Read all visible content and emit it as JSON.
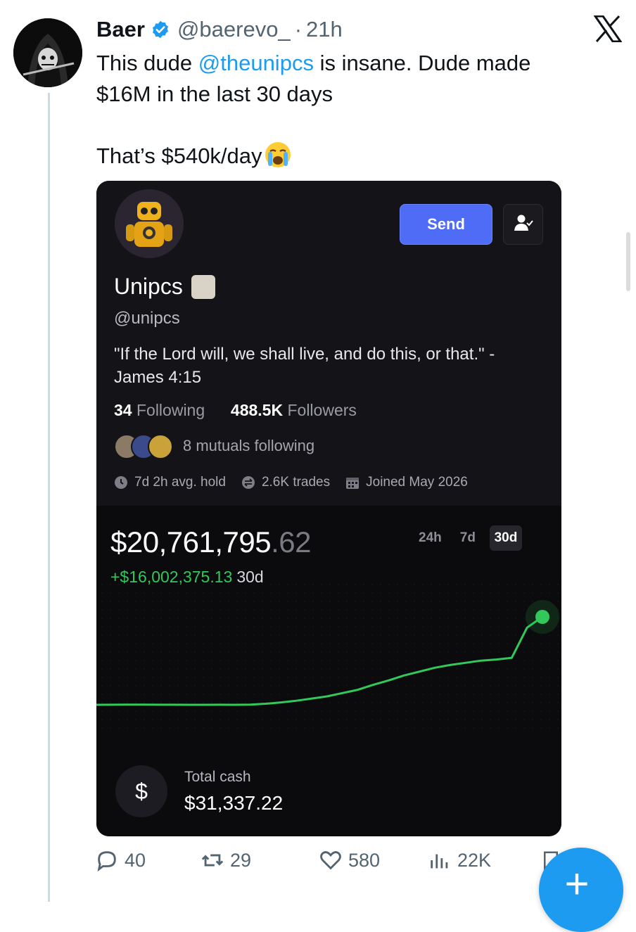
{
  "tweet": {
    "author_name": "Baer",
    "author_handle": "@baerevo_",
    "separator": "·",
    "time": "21h",
    "text_line1_pre": "This dude ",
    "mention": "@theunipcs",
    "text_line1_post": " is insane. Dude made",
    "text_line2": "$16M in the last 30 days",
    "text_line3": "That’s $540k/day"
  },
  "card": {
    "send_label": "Send",
    "display_name": "Unipcs",
    "handle": "@unipcs",
    "bio": "\"If the Lord will, we shall live, and do this, or that.\" - James 4:15",
    "following_count": "34",
    "following_label": "Following",
    "followers_count": "488.5K",
    "followers_label": "Followers",
    "mutuals_text": "8 mutuals following",
    "avg_hold": "7d 2h avg. hold",
    "trades": "2.6K trades",
    "joined": "Joined May 2026",
    "balance_main": "$20,761,795",
    "balance_cents": ".62",
    "gain": "+$16,002,375.13",
    "gain_period": "30d",
    "ranges": [
      "24h",
      "7d",
      "30d"
    ],
    "active_range": "30d",
    "cash_symbol": "$",
    "cash_label": "Total cash",
    "cash_value": "$31,337.22"
  },
  "chart_data": {
    "type": "line",
    "title": "",
    "xlabel": "",
    "ylabel": "",
    "series": [
      {
        "values": [
          4.76,
          4.77,
          4.78,
          4.78,
          4.77,
          4.77,
          4.76,
          4.76,
          4.77,
          4.76,
          4.8,
          4.95,
          5.2,
          5.5,
          5.9,
          6.3,
          6.9,
          7.5,
          8.4,
          9.2,
          10.1,
          10.8,
          11.5,
          12.0,
          12.4,
          12.8,
          13.0,
          13.3,
          18.8,
          20.76
        ]
      }
    ],
    "colors": {
      "line": "#32c85a",
      "end_dot": "#32c85a"
    }
  },
  "actions": {
    "replies": "40",
    "retweets": "29",
    "likes": "580",
    "views": "22K"
  },
  "icons": [
    "verified-badge-icon",
    "x-logo-icon",
    "loudly-crying-emoji-icon",
    "follow-user-icon",
    "clock-icon",
    "swap-icon",
    "calendar-icon",
    "reply-icon",
    "retweet-icon",
    "like-icon",
    "views-icon",
    "bookmark-icon",
    "compose-plus-icon"
  ]
}
